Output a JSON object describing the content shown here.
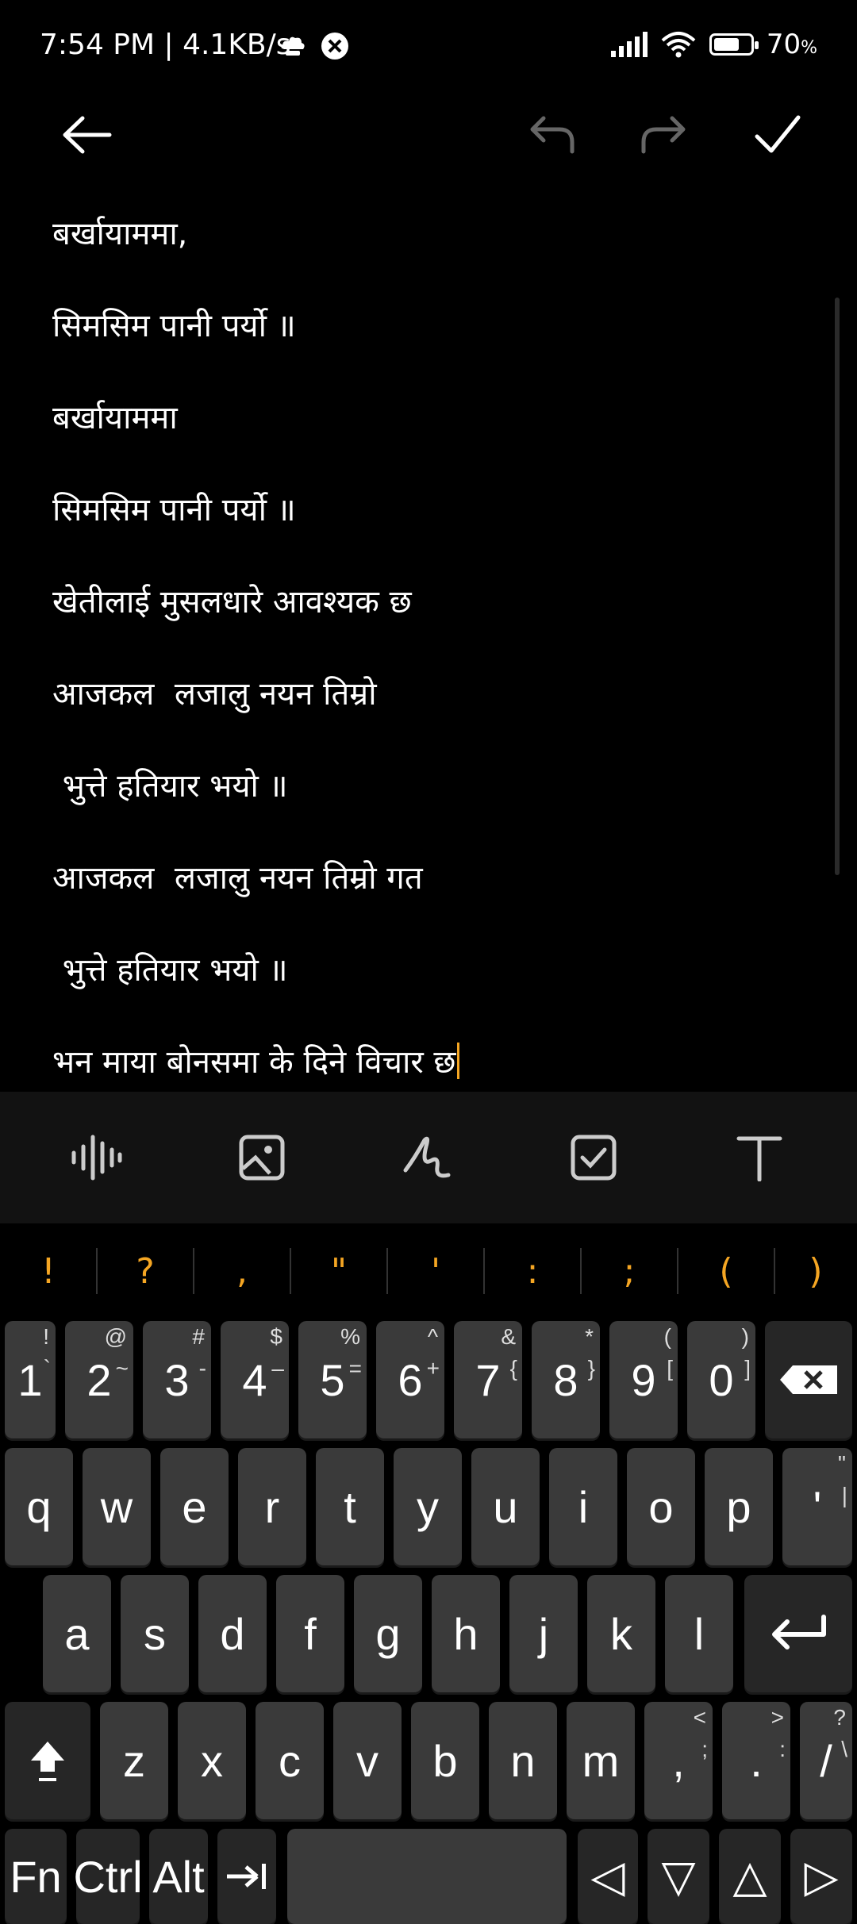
{
  "status": {
    "time_speed": "7:54 PM | 4.1KB/s",
    "battery": "70",
    "battery_level": 0.7
  },
  "toolbar": {
    "back_icon": "back-arrow-icon",
    "undo_icon": "undo-icon",
    "redo_icon": "redo-icon",
    "save_icon": "checkmark-icon"
  },
  "note": {
    "lines": [
      "बर्खायाममा,",
      "सिमसिम पानी पर्यो ॥",
      "बर्खायाममा",
      "सिमसिम पानी पर्यो ॥",
      "खेतीलाई मुसलधारे आवश्यक छ",
      "आजकल  लजालु नयन तिम्रो",
      " भुत्ते हतियार भयो ॥",
      "आजकल  लजालु नयन तिम्रो गत",
      " भुत्ते हतियार भयो ॥",
      "भन माया बोनसमा के दिने विचार छ"
    ]
  },
  "formatbar": {
    "items": [
      "audio-icon",
      "image-icon",
      "handwriting-icon",
      "checklist-icon",
      "text-format-icon"
    ]
  },
  "keyboard": {
    "symbols": [
      "!",
      "?",
      ",",
      "\"",
      "'",
      ":",
      ";",
      "(",
      ")"
    ],
    "numbers": [
      {
        "main": "1",
        "alt": "!",
        "alt2": "`"
      },
      {
        "main": "2",
        "alt": "@",
        "alt2": "~"
      },
      {
        "main": "3",
        "alt": "#",
        "alt2": "-"
      },
      {
        "main": "4",
        "alt": "$",
        "alt2": "–"
      },
      {
        "main": "5",
        "alt": "%",
        "alt2": "="
      },
      {
        "main": "6",
        "alt": "^",
        "alt2": "+"
      },
      {
        "main": "7",
        "alt": "&",
        "alt2": "{"
      },
      {
        "main": "8",
        "alt": "*",
        "alt2": "}"
      },
      {
        "main": "9",
        "alt": "(",
        "alt2": "["
      },
      {
        "main": "0",
        "alt": ")",
        "alt2": "]"
      }
    ],
    "row_q": [
      "q",
      "w",
      "e",
      "r",
      "t",
      "y",
      "u",
      "i",
      "o",
      "p",
      "'"
    ],
    "row_q_last_alt": "\"",
    "row_q_last_alt2": "|",
    "row_a": [
      "a",
      "s",
      "d",
      "f",
      "g",
      "h",
      "j",
      "k",
      "l"
    ],
    "row_z": [
      "z",
      "x",
      "c",
      "v",
      "b",
      "n",
      "m",
      ",",
      "."
    ],
    "row_z_comma_alt": "<",
    "row_z_comma_alt2": ";",
    "row_z_period_alt": ">",
    "row_z_period_alt2": ":",
    "slash": "/",
    "slash_alt": "?",
    "slash_alt2": "\\",
    "fn_label": "Fn",
    "ctrl_label": "Ctrl",
    "alt_label": "Alt",
    "arrows": [
      "◁",
      "▽",
      "△",
      "▷"
    ]
  }
}
